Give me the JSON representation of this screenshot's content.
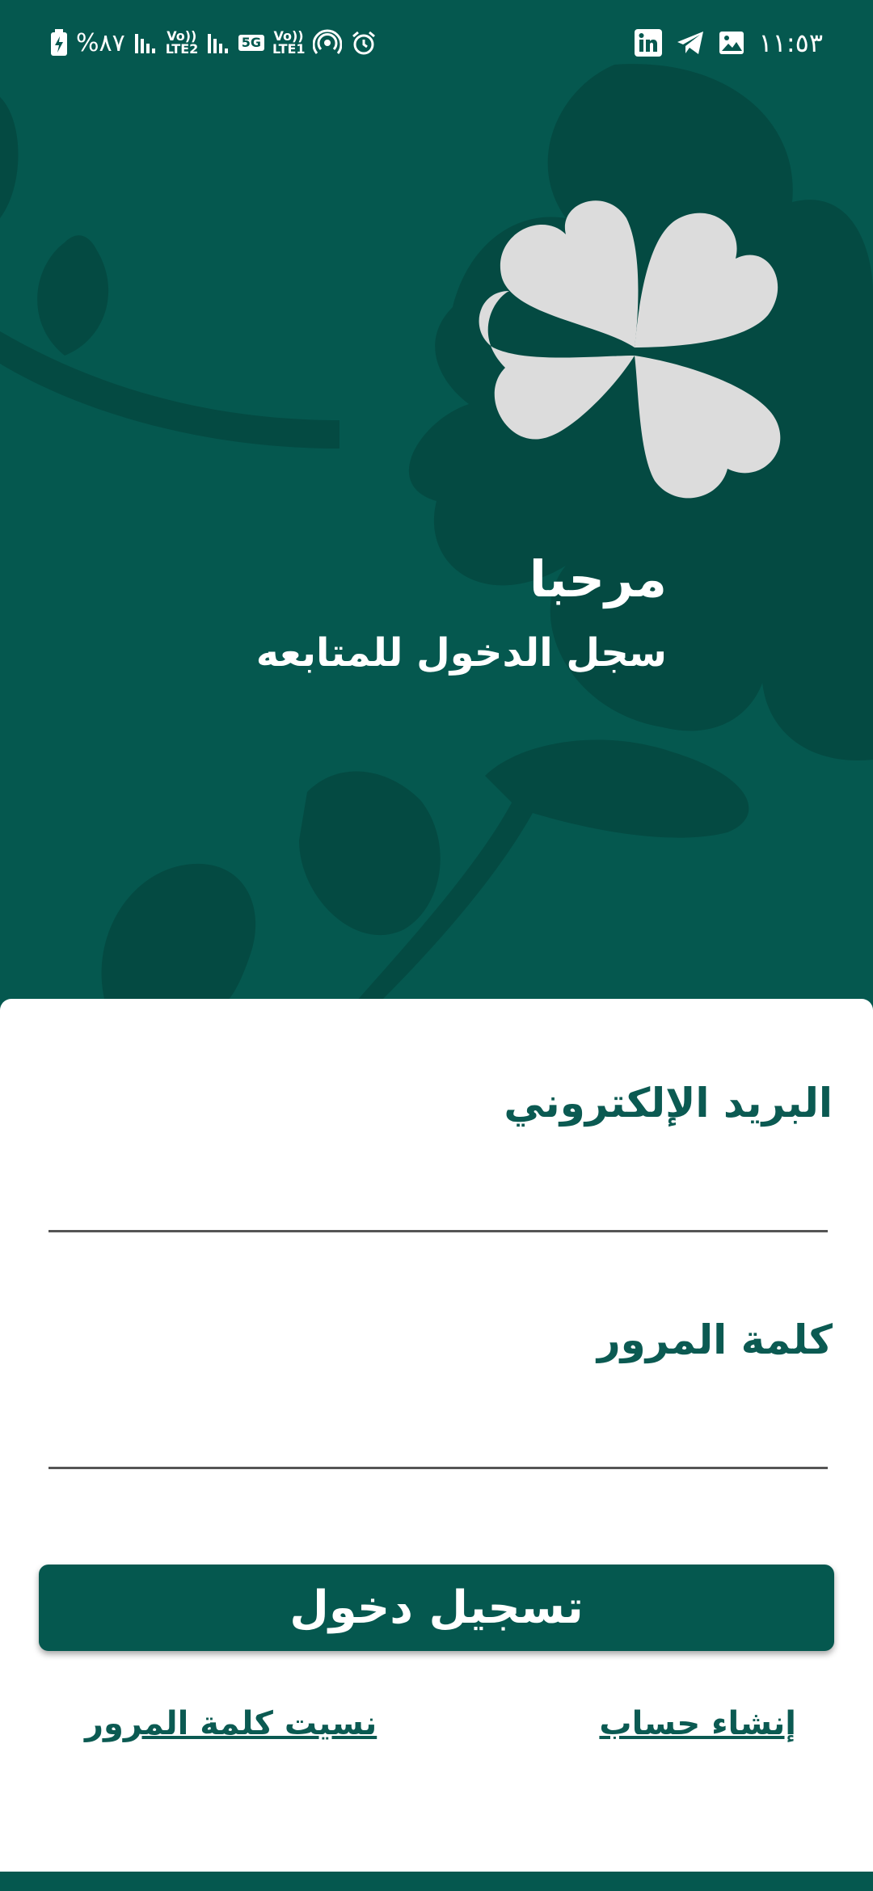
{
  "status_bar": {
    "battery": "%٨٧",
    "signal1_tag": "Vo)) LTE2",
    "network": "5G",
    "signal2_tag": "Vo)) LTE1",
    "time": "١١:٥٣"
  },
  "hero": {
    "title": "مرحبا",
    "subtitle": "سجل الدخول للمتابعه"
  },
  "form": {
    "email_label": "البريد الإلكتروني",
    "email_value": "",
    "password_label": "كلمة المرور",
    "password_value": "",
    "login_label": "تسجيل دخول"
  },
  "links": {
    "create_account": "إنشاء حساب",
    "forgot_password": "نسيت كلمة المرور"
  },
  "colors": {
    "primary": "#05584f",
    "decor": "#044a42",
    "logo": "#dcdcdc",
    "label": "#0b5a52"
  },
  "icons": [
    "battery-charging-icon",
    "signal-icon",
    "hotspot-icon",
    "alarm-icon",
    "linkedin-icon",
    "telegram-icon",
    "gallery-icon",
    "clover-logo"
  ]
}
